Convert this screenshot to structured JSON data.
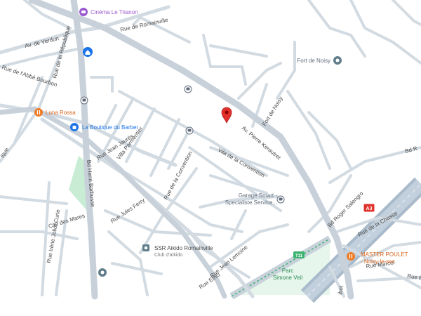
{
  "map": {
    "streets": {
      "rue_de_romainville": "Rue de Romainville",
      "av_de_verdun": "Av. de Verdun",
      "rue_de_la_republique": "Rue de la République",
      "rue_de_labbe_bourbon": "Rue de l'Abbé Bourbon",
      "av_pierre_kerautret": "Av. Pierre Kerautret",
      "fort_de_noisy_road": "Fort de Noisy",
      "rue_jean_jaures": "Rue Jean Jaurès",
      "villa_parmentier": "Villa Parmentier",
      "villa_de_la_convention": "Vila de la Convention",
      "rue_de_la_convention": "Rue de la Convention",
      "bd_henri_barbusse": "Bd Henri Barbusse",
      "cite_des_mares": "Cité des Mares",
      "rue_irene_joliot_curie": "Rue Irène Joliot Curie",
      "rue_jules_ferry": "Rue Jules Ferry",
      "rue_jean_lemoine": "Rue Jean Lemoine",
      "rue_ethis": "Rue Ethis",
      "bd_roger_salengro": "Bd Roger Salengro",
      "rue_de_la_chasse": "Rue de la Chasse",
      "rue_marcel": "Rue Marcel",
      "bd_right": "Bd R",
      "bd_ribot": "ibot",
      "rue_b": "Rue B",
      "rue_left": "ique"
    },
    "pois": {
      "cinema": "Cinéma Le Trianon",
      "fort": "Fort de Noisy",
      "luna_rossa": "Luna Rossa",
      "barber": "La Boutique du Barber",
      "garage_line1": "Garage Smart -",
      "garage_line2": "Specialiste Service...",
      "aikido": "SSR Aikido Romainville",
      "aikido_sub": "Club d'aïkido",
      "master_poulet_line1": "MASTER POULET",
      "master_poulet_line2": "- Noisy-le-sec",
      "parc_line1": "Parc",
      "parc_line2": "Simone Veil"
    },
    "shields": {
      "highway": "A3",
      "tram": "T11"
    },
    "colors": {
      "road": "#d3dbe2",
      "major_road": "#c8d1da",
      "highway": "#a9bacb",
      "park": "#c8ecd4",
      "pin": "#e0312c",
      "food": "#f07b24",
      "shop": "#1a73e8",
      "entertainment": "#9b59d0",
      "place": "#607d8b",
      "park_text": "#2e8b57",
      "rail": "#3cb371",
      "home": "#1a73e8"
    },
    "icons": {
      "pin": "location-pin-icon",
      "cinema": "movie-icon",
      "home": "home-icon",
      "fort": "landmark-icon",
      "food": "restaurant-icon",
      "shop": "shopping-bag-icon",
      "gym": "building-icon",
      "transit": "transit-icon"
    }
  }
}
